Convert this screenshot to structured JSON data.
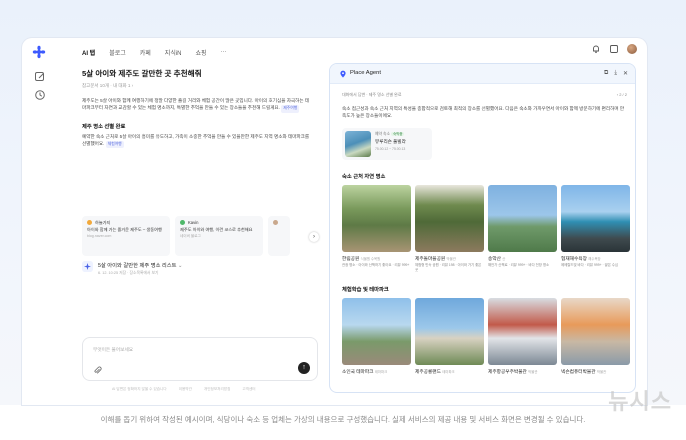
{
  "nav": {
    "tabs": [
      "AI 탭",
      "블로그",
      "카페",
      "지식iN",
      "쇼핑",
      "···"
    ]
  },
  "chat": {
    "title": "5살 아이와 제주도 갈만한 곳 추천해줘",
    "meta": "참고문서 10개 · 내 대화 1 ›",
    "para1": "제주도는 5살 아이와 함께 여행하기에 정말 다양한 즐길 거리와 체험 공간이 많은 곳입니다. 아이의 호기심을 자극하는 테마파크부터 자연과 교감할 수 있는 체험 명소까지, 특별한 추억을 만들 수 있는 장소들을 추천해 드릴게요.",
    "para1_tag": "제주여행",
    "section1_title": "제주 명소 선별 완료",
    "para2": "예약한 숙소 근처로 5살 아이의 흥미를 유도하고, 가족이 소중한 추억을 만들 수 있을만한 제주도 지역 명소와 테마파크를 선별했어요.",
    "para2_tag": "체험여행",
    "sources": [
      {
        "author": "하늘가지",
        "title": "아이와 함께 가는 즐거운 제주도 – 생동여행",
        "site": "blog.naver.com"
      },
      {
        "author": "Kavin",
        "title": "제주도 아이와 여행, 이런 코스로 추천해요",
        "site": "네이버 블로그"
      },
      {
        "author": "",
        "title": "",
        "site": ""
      }
    ],
    "list_card": {
      "title": "5살 아이와 갈만한 제주 명소 리스트",
      "sub": "6. 12. 10:25 저장 · 장소목록에서 보기"
    },
    "input_placeholder": "무엇이든 물어보세요",
    "footer_links": [
      "AI 답변은 정확하지 않을 수 있습니다",
      "이용약관",
      "개인정보처리방침",
      "고객센터"
    ]
  },
  "panel": {
    "title": "Place Agent",
    "context": "대화에서 답변 · 제주 명소 선별 완료",
    "pager": "‹ 2 / 2",
    "desc": "숙소 접근성과 숙소 근처 지역의 특성을 종합적으로 검토해 최적의 장소를 선별했어요. 다음은 숙소와 가까우면서 아이와 함께 방문하기에 편리하며 만족도가 높은 장소들이에요.",
    "hotel": {
      "label": "예약 숙소",
      "badge": "숙박중",
      "name": "뷰루리슨 풀빌라",
      "dates": "75.00.12 ~ 75.00.13"
    },
    "section_nature": "숙소 근처 자연 명소",
    "section_theme": "체험학습 및 테마파크",
    "nature_places": [
      {
        "name": "한림공원",
        "cat": "식물원 수목원",
        "desc": "관광 명소 · 아이와 산책하기 좋아요 · 리뷰 999+"
      },
      {
        "name": "제주돌마을공원",
        "cat": "박물관",
        "desc": "체험형 민속 공원 · 리뷰 198 · 아이와 가기 좋은 곳"
      },
      {
        "name": "송악산",
        "cat": "산",
        "desc": "해안가 산책로 · 리뷰 999+ · 바다 전망 명소"
      },
      {
        "name": "협재해수욕장",
        "cat": "해수욕장",
        "desc": "에메랄드빛 바다 · 리뷰 999+ · 얕은 수심"
      }
    ],
    "theme_places": [
      {
        "name": "소인국 테마파크",
        "cat": "테마파크"
      },
      {
        "name": "제주공룡랜드",
        "cat": "테마파크"
      },
      {
        "name": "제주항공우주박물관",
        "cat": "박물관"
      },
      {
        "name": "넥슨컴퓨터박물관",
        "cat": "박물관"
      }
    ]
  },
  "caption": "이해를 돕기 위하여 작성된 예시이며, 식당이나 숙소 등 업체는 가상의 내용으로 구성했습니다. 실제 서비스의 제공 내용 및 서비스 화면은 변경될 수 있습니다.",
  "watermark": "뉴시스"
}
